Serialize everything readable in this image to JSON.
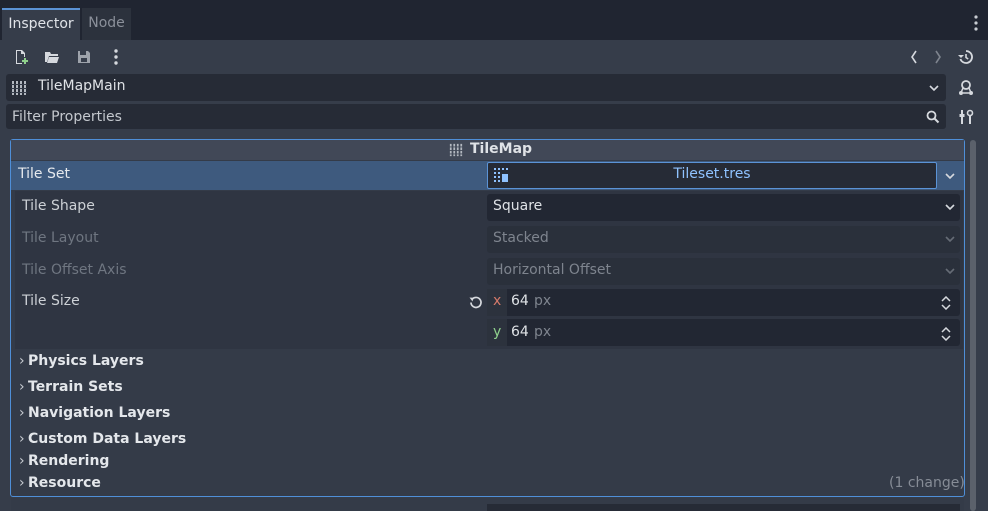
{
  "tabs": [
    {
      "label": "Inspector",
      "active": true
    },
    {
      "label": "Node",
      "active": false
    }
  ],
  "toolbar": {
    "new_icon": "new-resource-icon",
    "open_icon": "folder-open-icon",
    "save_icon": "save-icon",
    "more_icon": "kebab-icon",
    "back_icon": "chevron-left-icon",
    "forward_icon": "chevron-right-icon",
    "history_icon": "history-icon"
  },
  "node_selector": {
    "name": "TileMapMain"
  },
  "filter": {
    "placeholder": "Filter Properties"
  },
  "section_header": {
    "title": "TileMap"
  },
  "properties": {
    "tile_set": {
      "label": "Tile Set",
      "value": "Tileset.tres"
    },
    "tile_shape": {
      "label": "Tile Shape",
      "value": "Square"
    },
    "tile_layout": {
      "label": "Tile Layout",
      "value": "Stacked"
    },
    "tile_offset_axis": {
      "label": "Tile Offset Axis",
      "value": "Horizontal Offset"
    },
    "tile_size": {
      "label": "Tile Size",
      "x_label": "x",
      "x_value": "64",
      "x_unit": "px",
      "y_label": "y",
      "y_value": "64",
      "y_unit": "px"
    }
  },
  "groups": [
    {
      "label": "Physics Layers"
    },
    {
      "label": "Terrain Sets"
    },
    {
      "label": "Navigation Layers"
    },
    {
      "label": "Custom Data Layers"
    },
    {
      "label": "Rendering"
    },
    {
      "label": "Resource",
      "note": "(1 change)"
    }
  ],
  "colors": {
    "accent": "#5b93d6",
    "selected_row": "#3e5a7e",
    "link_text": "#8fc2ff",
    "x_axis": "#d4796a",
    "y_axis": "#8fd18c"
  }
}
